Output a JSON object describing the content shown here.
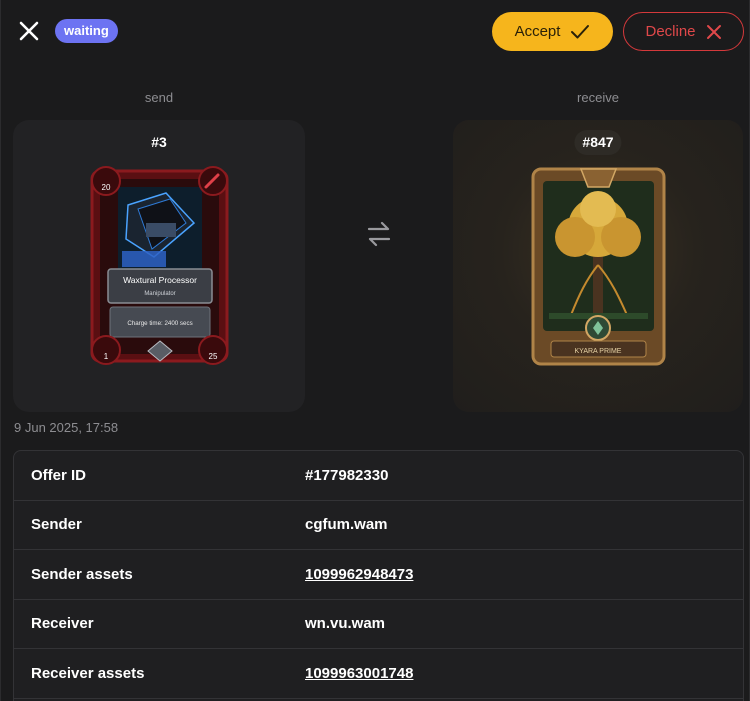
{
  "header": {
    "status_badge": "waiting",
    "accept_label": "Accept",
    "decline_label": "Decline"
  },
  "trade": {
    "send_caption": "send",
    "receive_caption": "receive",
    "send_asset": {
      "number": "#3",
      "card_name": "Waxtural Processor",
      "card_type": "Manipulator",
      "charge_text": "Charge time: 2400 secs",
      "stat_top_left": "20",
      "stat_bottom_left": "1",
      "stat_bottom_right": "25"
    },
    "receive_asset": {
      "number": "#847",
      "card_name": "KYARA PRIME"
    },
    "date": "9 Jun 2025, 17:58"
  },
  "details": [
    {
      "key": "Offer ID",
      "value": "#177982330",
      "link": false
    },
    {
      "key": "Sender",
      "value": "cgfum.wam",
      "link": false
    },
    {
      "key": "Sender assets",
      "value": "1099962948473",
      "link": true
    },
    {
      "key": "Receiver",
      "value": "wn.vu.wam",
      "link": false
    },
    {
      "key": "Receiver assets",
      "value": "1099963001748",
      "link": true
    }
  ],
  "colors": {
    "accent_accept": "#f6b51c",
    "accent_decline": "#d4393b",
    "badge": "#6d73f2"
  }
}
